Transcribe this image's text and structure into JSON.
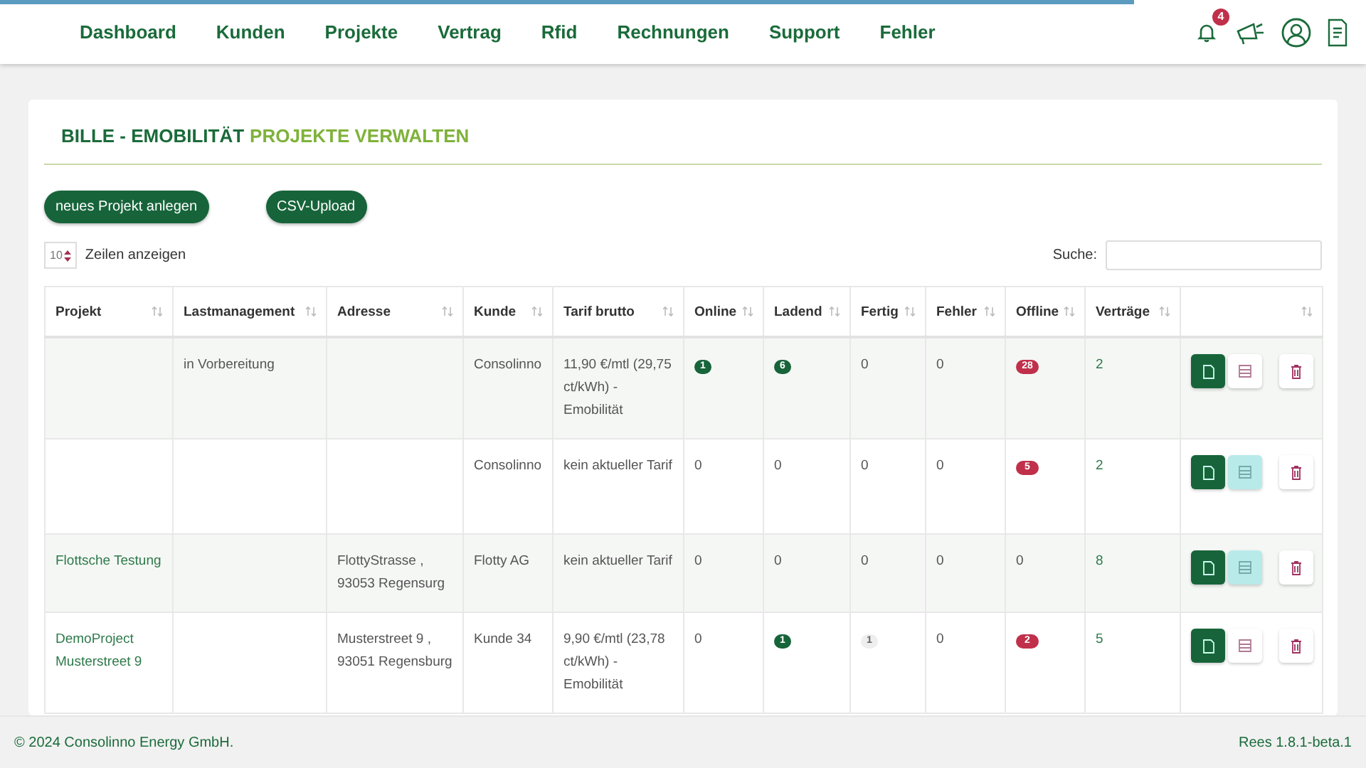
{
  "loading_bar": {
    "level": 0.83
  },
  "nav": {
    "items": [
      "Dashboard",
      "Kunden",
      "Projekte",
      "Vertrag",
      "Rfid",
      "Rechnungen",
      "Support",
      "Fehler"
    ],
    "notification_count": "4"
  },
  "page": {
    "title_part_1": "BILLE - EMOBILITÄT",
    "title_part_2": "PROJEKTE VERWALTEN",
    "buttons": [
      "neues Projekt anlegen",
      "CSV-Upload"
    ],
    "page_size": "10",
    "page_size_label": "Zeilen anzeigen",
    "search_label": "Suche:"
  },
  "table": {
    "columns": [
      "Projekt",
      "Lastmanagement",
      "Adresse",
      "Kunde",
      "Tarif brutto",
      "Online",
      "Ladend",
      "Fertig",
      "Fehler",
      "Offline",
      "Verträge",
      ""
    ],
    "rows": [
      {
        "projekt": "",
        "lastmanagement": "in Vorbereitung",
        "adresse": "",
        "kunde": "Consolinno",
        "tarif": "11,90 €/mtl (29,75 ct/kWh) - Emobilität",
        "counts": [
          {
            "text": "1",
            "kind": "success"
          },
          {
            "text": "6",
            "kind": "success"
          },
          {
            "text": "0",
            "kind": "plain"
          },
          {
            "text": "0",
            "kind": "plain"
          },
          {
            "text": "28",
            "kind": "danger"
          }
        ],
        "vertraege": "2",
        "active": false
      },
      {
        "projekt": "",
        "lastmanagement": "",
        "adresse": "",
        "kunde": "Consolinno",
        "tarif": "kein aktueller Tarif",
        "counts": [
          {
            "text": "0",
            "kind": "plain"
          },
          {
            "text": "0",
            "kind": "plain"
          },
          {
            "text": "0",
            "kind": "plain"
          },
          {
            "text": "0",
            "kind": "plain"
          },
          {
            "text": "5",
            "kind": "danger"
          }
        ],
        "vertraege": "2",
        "active": true
      },
      {
        "projekt": "Flottsche Testung",
        "lastmanagement": "",
        "adresse": "FlottyStrasse , 93053 Regensurg",
        "kunde": "Flotty AG",
        "tarif": "kein aktueller Tarif",
        "counts": [
          {
            "text": "0",
            "kind": "plain"
          },
          {
            "text": "0",
            "kind": "plain"
          },
          {
            "text": "0",
            "kind": "plain"
          },
          {
            "text": "0",
            "kind": "plain"
          },
          {
            "text": "0",
            "kind": "plain"
          }
        ],
        "vertraege": "8",
        "active": true
      },
      {
        "projekt": "DemoProject Musterstreet 9",
        "lastmanagement": "",
        "adresse": "Musterstreet 9 , 93051 Regensburg",
        "kunde": "Kunde 34",
        "tarif": "9,90 €/mtl (23,78 ct/kWh) - Emobilität",
        "counts": [
          {
            "text": "0",
            "kind": "plain"
          },
          {
            "text": "1",
            "kind": "success"
          },
          {
            "text": "1",
            "kind": "muted"
          },
          {
            "text": "0",
            "kind": "plain"
          },
          {
            "text": "2",
            "kind": "danger"
          }
        ],
        "vertraege": "5",
        "active": false
      }
    ]
  },
  "footer": {
    "copyright": "© 2024 Consolinno Energy GmbH.",
    "version": "Rees 1.8.1-beta.1"
  }
}
